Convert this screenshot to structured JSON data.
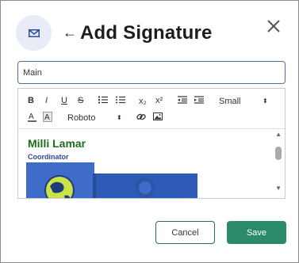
{
  "header": {
    "title": "Add Signature",
    "back_icon": "arrow-left-icon",
    "envelope_icon": "envelope-icon",
    "close_icon": "close-icon"
  },
  "form": {
    "signature_name_value": "Main"
  },
  "toolbar": {
    "bold": "B",
    "italic": "I",
    "underline": "U",
    "strikethrough": "S",
    "subscript": "x₂",
    "superscript": "x²",
    "size_select": "Small",
    "font_select": "Roboto"
  },
  "signature": {
    "name": "Milli Lamar",
    "role": "Coordinator"
  },
  "buttons": {
    "cancel": "Cancel",
    "save": "Save"
  },
  "colors": {
    "name_green": "#1e6b1e",
    "role_blue": "#2b4aa0",
    "save_bg": "#2a8a6a",
    "input_border": "#4a6fa5"
  }
}
